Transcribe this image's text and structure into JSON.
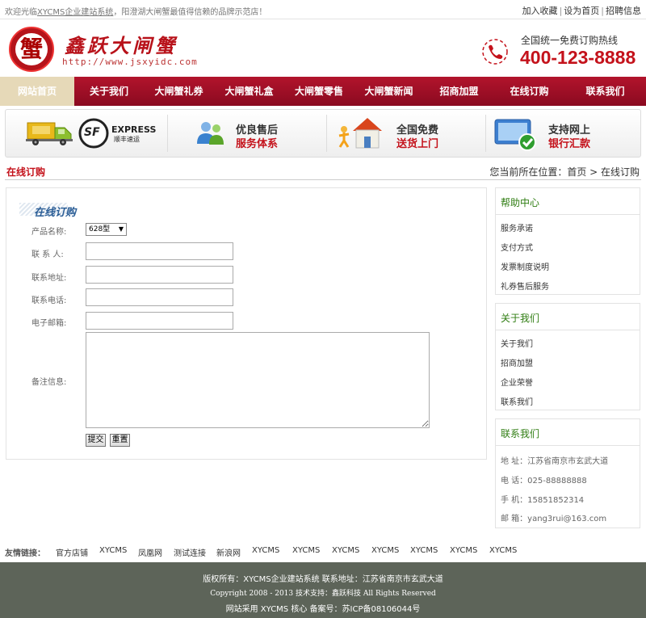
{
  "topbar": {
    "welcome_prefix": "欢迎光临",
    "welcome_link": "XYCMS企业建站系统",
    "welcome_suffix": "，阳澄湖大闸蟹最值得信赖的品牌示范店！",
    "links": [
      "加入收藏",
      "设为首页",
      "招聘信息"
    ]
  },
  "header": {
    "logo_glyph": "蟹",
    "logo_name": "鑫跃大闸蟹",
    "logo_url": "http://www.jsxyidc.com",
    "hotline_label": "全国统一免费订购热线",
    "hotline_number": "400-123-8888"
  },
  "nav": {
    "items": [
      "网站首页",
      "关于我们",
      "大闸蟹礼券",
      "大闸蟹礼盒",
      "大闸蟹零售",
      "大闸蟹新闻",
      "招商加盟",
      "在线订购",
      "联系我们"
    ],
    "active_index": 0
  },
  "banner": {
    "express_label": "EXPRESS",
    "express_sub": "顺丰速运",
    "sf_logo": "SF",
    "items": [
      {
        "line1": "优良售后",
        "line2": "服务体系"
      },
      {
        "line1": "全国免费",
        "line2": "送货上门"
      },
      {
        "line1": "支持网上",
        "line2": "银行汇款"
      }
    ]
  },
  "location": {
    "title": "在线订购",
    "crumb": "您当前所在位置：首页 > 在线订购"
  },
  "form": {
    "title": "在线订购",
    "labels": {
      "product": "产品名称:",
      "contact": "联 系 人:",
      "address": "联系地址:",
      "phone": "联系电话:",
      "email": "电子邮箱:",
      "note": "备注信息:"
    },
    "product_selected": "628型",
    "values": {
      "contact": "",
      "address": "",
      "phone": "",
      "email": "",
      "note": ""
    },
    "submit_label": "提交",
    "reset_label": "重置"
  },
  "sidebar": {
    "help": {
      "title": "帮助中心",
      "items": [
        "服务承诺",
        "支付方式",
        "发票制度说明",
        "礼券售后服务"
      ]
    },
    "about": {
      "title": "关于我们",
      "items": [
        "关于我们",
        "招商加盟",
        "企业荣誉",
        "联系我们"
      ]
    },
    "contact": {
      "title": "联系我们",
      "address": "地 址：江苏省南京市玄武大道",
      "tel": "电 话：025-88888888",
      "mobile": "手 机：15851852314",
      "email": "邮 箱：yang3rui@163.com"
    }
  },
  "friend_links": {
    "label": "友情链接：",
    "items": [
      "官方店铺",
      "XYCMS",
      "凤凰网",
      "测试连接",
      "新浪网",
      "XYCMS",
      "XYCMS",
      "XYCMS",
      "XYCMS",
      "XYCMS",
      "XYCMS",
      "XYCMS"
    ]
  },
  "footer": {
    "line1": "版权所有：XYCMS企业建站系统  联系地址：江苏省南京市玄武大道",
    "line2": "Copyright 2008 - 2013  技术支持：鑫跃科技 All Rights Reserved",
    "line3": "网站采用 XYCMS 核心 备案号：苏ICP备08106044号"
  },
  "colors": {
    "brand_red": "#c4121b",
    "nav_bg": "#a0102a",
    "nav_active": "#e6d9b8",
    "sidebar_title": "#2f7d12",
    "footer_bg": "#5d6459"
  }
}
